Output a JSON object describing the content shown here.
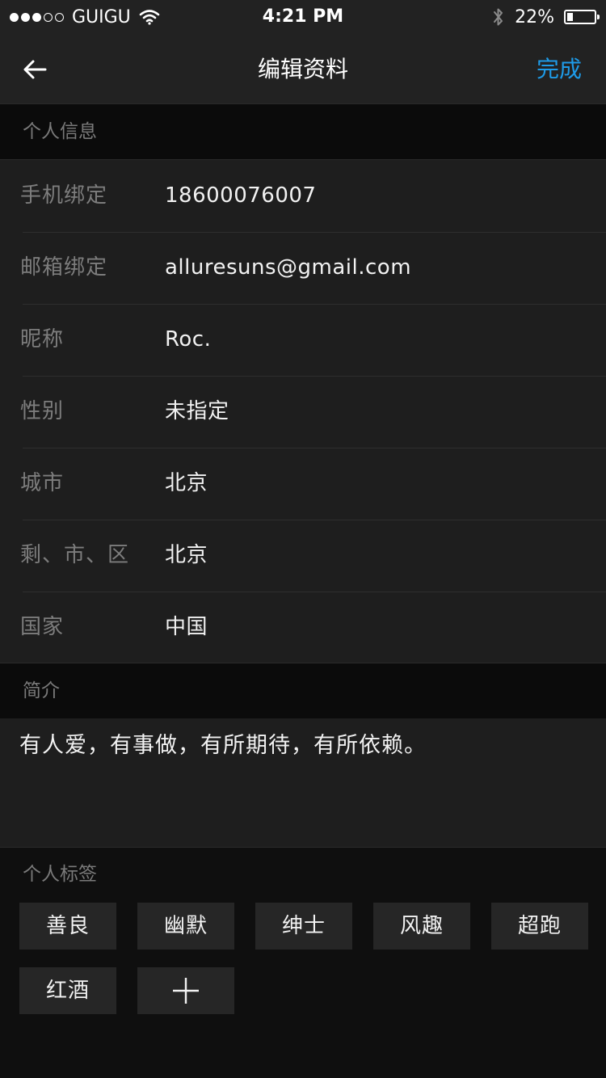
{
  "status_bar": {
    "carrier": "GUIGU",
    "signal_bars": 3,
    "signal_total": 5,
    "time": "4:21 PM",
    "battery_percent": "22%",
    "battery_level": 0.22
  },
  "nav": {
    "title": "编辑资料",
    "done_label": "完成",
    "accent_color": "#1e9be8"
  },
  "personal_info": {
    "header": "个人信息",
    "rows": [
      {
        "label": "手机绑定",
        "value": "18600076007"
      },
      {
        "label": "邮箱绑定",
        "value": "alluresuns@gmail.com"
      },
      {
        "label": "昵称",
        "value": "Roc."
      },
      {
        "label": "性别",
        "value": "未指定"
      },
      {
        "label": "城市",
        "value": "北京"
      },
      {
        "label": "剩、市、区",
        "value": "北京"
      },
      {
        "label": "国家",
        "value": "中国"
      }
    ]
  },
  "bio": {
    "header": "简介",
    "text": "有人爱，有事做，有所期待，有所依赖。"
  },
  "tags": {
    "header": "个人标签",
    "items": [
      "善良",
      "幽默",
      "绅士",
      "风趣",
      "超跑",
      "红酒"
    ],
    "add_icon": "plus-icon"
  }
}
